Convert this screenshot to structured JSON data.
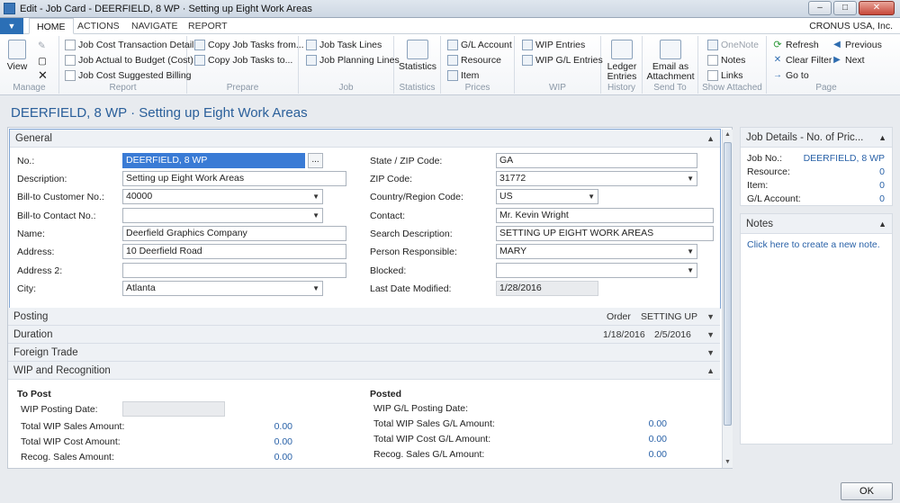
{
  "window": {
    "title": "Edit - Job Card - DEERFIELD, 8 WP · Setting up Eight Work Areas",
    "minimize": "–",
    "maximize": "□",
    "close": "✕"
  },
  "tabs": {
    "menu": "▼",
    "items": [
      "HOME",
      "ACTIONS",
      "NAVIGATE",
      "REPORT"
    ],
    "company": "CRONUS USA, Inc."
  },
  "ribbon": {
    "manage": {
      "label": "Manage",
      "view": "View"
    },
    "report": {
      "label": "Report",
      "items": [
        "Job Cost Transaction Detail",
        "Job Actual to Budget (Cost)",
        "Job Cost Suggested Billing"
      ]
    },
    "prepare": {
      "label": "Prepare",
      "items": [
        "Copy Job Tasks from...",
        "Copy Job Tasks to..."
      ]
    },
    "job": {
      "label": "Job",
      "items": [
        "Job Task Lines",
        "Job Planning Lines"
      ]
    },
    "statistics": {
      "label": "Statistics",
      "button": "Statistics"
    },
    "prices": {
      "label": "Prices",
      "items": [
        "G/L Account",
        "Resource",
        "Item"
      ]
    },
    "wip": {
      "label": "WIP",
      "items": [
        "WIP Entries",
        "WIP G/L Entries"
      ]
    },
    "history": {
      "label": "History",
      "button_line1": "Ledger",
      "button_line2": "Entries"
    },
    "sendto": {
      "label": "Send To",
      "button_line1": "Email as",
      "button_line2": "Attachment"
    },
    "attached": {
      "label": "Show Attached",
      "items": [
        "OneNote",
        "Notes",
        "Links"
      ]
    },
    "page": {
      "label": "Page",
      "items": [
        "Refresh",
        "Clear Filter",
        "Go to",
        "Previous",
        "Next"
      ]
    }
  },
  "page_title": "DEERFIELD, 8 WP · Setting up Eight Work Areas",
  "general": {
    "header": "General",
    "left": [
      {
        "label": "No.:",
        "value": "DEERFIELD, 8 WP"
      },
      {
        "label": "Description:",
        "value": "Setting up Eight Work Areas"
      },
      {
        "label": "Bill-to Customer No.:",
        "value": "40000"
      },
      {
        "label": "Bill-to Contact No.:",
        "value": ""
      },
      {
        "label": "Name:",
        "value": "Deerfield Graphics Company"
      },
      {
        "label": "Address:",
        "value": "10 Deerfield Road"
      },
      {
        "label": "Address 2:",
        "value": ""
      },
      {
        "label": "City:",
        "value": "Atlanta"
      }
    ],
    "right": [
      {
        "label": "State / ZIP Code:",
        "value": "GA"
      },
      {
        "label": "ZIP Code:",
        "value": "31772"
      },
      {
        "label": "Country/Region Code:",
        "value": "US"
      },
      {
        "label": "Contact:",
        "value": "Mr. Kevin Wright"
      },
      {
        "label": "Search Description:",
        "value": "SETTING UP EIGHT WORK AREAS"
      },
      {
        "label": "Person Responsible:",
        "value": "MARY"
      },
      {
        "label": "Blocked:",
        "value": ""
      },
      {
        "label": "Last Date Modified:",
        "value": "1/28/2016"
      }
    ],
    "assist_edit": "..."
  },
  "sections": {
    "posting": {
      "label": "Posting",
      "summary1": "Order",
      "summary2": "SETTING UP"
    },
    "duration": {
      "label": "Duration",
      "summary1": "1/18/2016",
      "summary2": "2/5/2016"
    },
    "foreign": {
      "label": "Foreign Trade"
    },
    "wip": {
      "label": "WIP and Recognition"
    }
  },
  "wip": {
    "to_post": {
      "header": "To Post",
      "rows": [
        {
          "label": "WIP Posting Date:",
          "value": ""
        },
        {
          "label": "Total WIP Sales Amount:",
          "value": "0.00"
        },
        {
          "label": "Total WIP Cost Amount:",
          "value": "0.00"
        },
        {
          "label": "Recog. Sales Amount:",
          "value": "0.00"
        }
      ]
    },
    "posted": {
      "header": "Posted",
      "rows": [
        {
          "label": "WIP G/L Posting Date:",
          "value": ""
        },
        {
          "label": "Total WIP Sales G/L Amount:",
          "value": "0.00"
        },
        {
          "label": "Total WIP Cost G/L Amount:",
          "value": "0.00"
        },
        {
          "label": "Recog. Sales G/L Amount:",
          "value": "0.00"
        }
      ]
    }
  },
  "factbox_job": {
    "header": "Job Details - No. of Pric...",
    "rows": [
      {
        "label": "Job No.:",
        "value": "DEERFIELD, 8 WP"
      },
      {
        "label": "Resource:",
        "value": "0"
      },
      {
        "label": "Item:",
        "value": "0"
      },
      {
        "label": "G/L Account:",
        "value": "0"
      }
    ]
  },
  "factbox_notes": {
    "header": "Notes",
    "link": "Click here to create a new note."
  },
  "ok": "OK",
  "icons": {
    "collapse": "▲",
    "expand": "▼",
    "dropdown": "▼"
  }
}
